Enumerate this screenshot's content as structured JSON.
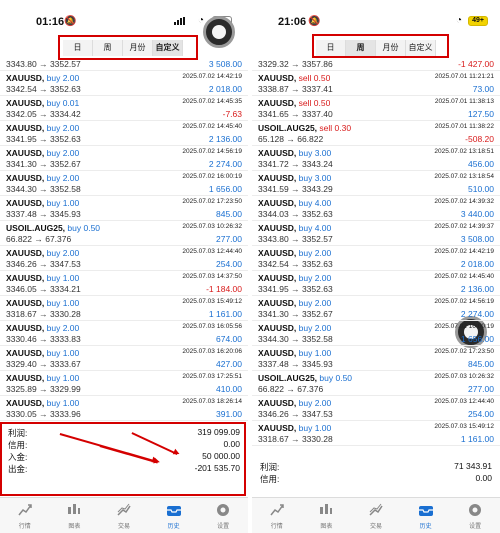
{
  "left": {
    "status": {
      "time": "01:16",
      "battery": ""
    },
    "segments": [
      "日",
      "周",
      "月份",
      "自定义"
    ],
    "active_segment": 3,
    "rows": [
      {
        "symbol": "",
        "dir": "",
        "dirclass": "",
        "datetime": "",
        "prices": "3343.80 → 3352.57",
        "pl": "3 508.00",
        "plclass": "pos",
        "first": true
      },
      {
        "symbol": "XAUUSD,",
        "dir": "buy 2.00",
        "dirclass": "buy",
        "datetime": "2025.07.02 14:42:19",
        "prices": "3342.54 → 3352.63",
        "pl": "2 018.00",
        "plclass": "pos"
      },
      {
        "symbol": "XAUUSD,",
        "dir": "buy 0.01",
        "dirclass": "buy",
        "datetime": "2025.07.02 14:45:35",
        "prices": "3342.05 → 3334.42",
        "pl": "-7.63",
        "plclass": "neg"
      },
      {
        "symbol": "XAUUSD,",
        "dir": "buy 2.00",
        "dirclass": "buy",
        "datetime": "2025.07.02 14:45:40",
        "prices": "3341.95 → 3352.63",
        "pl": "2 136.00",
        "plclass": "pos"
      },
      {
        "symbol": "XAUUSD,",
        "dir": "buy 2.00",
        "dirclass": "buy",
        "datetime": "2025.07.02 14:56:19",
        "prices": "3341.30 → 3352.67",
        "pl": "2 274.00",
        "plclass": "pos"
      },
      {
        "symbol": "XAUUSD,",
        "dir": "buy 2.00",
        "dirclass": "buy",
        "datetime": "2025.07.02 16:00:19",
        "prices": "3344.30 → 3352.58",
        "pl": "1 656.00",
        "plclass": "pos"
      },
      {
        "symbol": "XAUUSD,",
        "dir": "buy 1.00",
        "dirclass": "buy",
        "datetime": "2025.07.02 17:23:50",
        "prices": "3337.48 → 3345.93",
        "pl": "845.00",
        "plclass": "pos"
      },
      {
        "symbol": "USOIL.AUG25,",
        "dir": "buy 0.50",
        "dirclass": "buy",
        "datetime": "2025.07.03 10:26:32",
        "prices": "66.822 → 67.376",
        "pl": "277.00",
        "plclass": "pos"
      },
      {
        "symbol": "XAUUSD,",
        "dir": "buy 2.00",
        "dirclass": "buy",
        "datetime": "2025.07.03 12:44:40",
        "prices": "3346.26 → 3347.53",
        "pl": "254.00",
        "plclass": "pos"
      },
      {
        "symbol": "XAUUSD,",
        "dir": "buy 1.00",
        "dirclass": "buy",
        "datetime": "2025.07.03 14:37:50",
        "prices": "3346.05 → 3334.21",
        "pl": "-1 184.00",
        "plclass": "neg"
      },
      {
        "symbol": "XAUUSD,",
        "dir": "buy 1.00",
        "dirclass": "buy",
        "datetime": "2025.07.03 15:49:12",
        "prices": "3318.67 → 3330.28",
        "pl": "1 161.00",
        "plclass": "pos"
      },
      {
        "symbol": "XAUUSD,",
        "dir": "buy 2.00",
        "dirclass": "buy",
        "datetime": "2025.07.03 16:05:56",
        "prices": "3330.46 → 3333.83",
        "pl": "674.00",
        "plclass": "pos"
      },
      {
        "symbol": "XAUUSD,",
        "dir": "buy 1.00",
        "dirclass": "buy",
        "datetime": "2025.07.03 16:20:06",
        "prices": "3329.40 → 3333.67",
        "pl": "427.00",
        "plclass": "pos"
      },
      {
        "symbol": "XAUUSD,",
        "dir": "buy 1.00",
        "dirclass": "buy",
        "datetime": "2025.07.03 17:25:51",
        "prices": "3325.89 → 3329.99",
        "pl": "410.00",
        "plclass": "pos"
      },
      {
        "symbol": "XAUUSD,",
        "dir": "buy 1.00",
        "dirclass": "buy",
        "datetime": "2025.07.03 18:26:14",
        "prices": "3330.05 → 3333.96",
        "pl": "391.00",
        "plclass": "pos"
      }
    ],
    "summary": [
      {
        "label": "利润:",
        "value": "319 099.09"
      },
      {
        "label": "信用:",
        "value": "0.00"
      },
      {
        "label": "入金:",
        "value": "50 000.00"
      },
      {
        "label": "出金:",
        "value": "-201 535.70"
      }
    ]
  },
  "right": {
    "status": {
      "time": "21:06",
      "battery": "49+"
    },
    "segments": [
      "日",
      "周",
      "月份",
      "自定义"
    ],
    "active_segment": 1,
    "rows": [
      {
        "symbol": "",
        "dir": "",
        "dirclass": "",
        "datetime": "",
        "prices": "3329.32 → 3357.86",
        "pl": "-1 427.00",
        "plclass": "neg",
        "first": true
      },
      {
        "symbol": "XAUUSD,",
        "dir": "sell 0.50",
        "dirclass": "sell",
        "datetime": "2025.07.01 11:21:21",
        "prices": "3338.87 → 3337.41",
        "pl": "73.00",
        "plclass": "pos"
      },
      {
        "symbol": "XAUUSD,",
        "dir": "sell 0.50",
        "dirclass": "sell",
        "datetime": "2025.07.01 11:38:13",
        "prices": "3341.65 → 3337.40",
        "pl": "127.50",
        "plclass": "pos"
      },
      {
        "symbol": "USOIL.AUG25,",
        "dir": "sell 0.30",
        "dirclass": "sell",
        "datetime": "2025.07.01 11:38:22",
        "prices": "65.128 → 66.822",
        "pl": "-508.20",
        "plclass": "neg"
      },
      {
        "symbol": "XAUUSD,",
        "dir": "buy 3.00",
        "dirclass": "buy",
        "datetime": "2025.07.02 13:18:51",
        "prices": "3341.72 → 3343.24",
        "pl": "456.00",
        "plclass": "pos"
      },
      {
        "symbol": "XAUUSD,",
        "dir": "buy 3.00",
        "dirclass": "buy",
        "datetime": "2025.07.02 13:18:54",
        "prices": "3341.59 → 3343.29",
        "pl": "510.00",
        "plclass": "pos"
      },
      {
        "symbol": "XAUUSD,",
        "dir": "buy 4.00",
        "dirclass": "buy",
        "datetime": "2025.07.02 14:39:32",
        "prices": "3344.03 → 3352.63",
        "pl": "3 440.00",
        "plclass": "pos"
      },
      {
        "symbol": "XAUUSD,",
        "dir": "buy 4.00",
        "dirclass": "buy",
        "datetime": "2025.07.02 14:39:37",
        "prices": "3343.80 → 3352.57",
        "pl": "3 508.00",
        "plclass": "pos"
      },
      {
        "symbol": "XAUUSD,",
        "dir": "buy 2.00",
        "dirclass": "buy",
        "datetime": "2025.07.02 14:42:19",
        "prices": "3342.54 → 3352.63",
        "pl": "2 018.00",
        "plclass": "pos"
      },
      {
        "symbol": "XAUUSD,",
        "dir": "buy 2.00",
        "dirclass": "buy",
        "datetime": "2025.07.02 14:45:40",
        "prices": "3341.95 → 3352.63",
        "pl": "2 136.00",
        "plclass": "pos"
      },
      {
        "symbol": "XAUUSD,",
        "dir": "buy 2.00",
        "dirclass": "buy",
        "datetime": "2025.07.02 14:56:19",
        "prices": "3341.30 → 3352.67",
        "pl": "2 274.00",
        "plclass": "pos"
      },
      {
        "symbol": "XAUUSD,",
        "dir": "buy 2.00",
        "dirclass": "buy",
        "datetime": "2025.07.02 16:00:19",
        "prices": "3344.30 → 3352.58",
        "pl": "1 656.00",
        "plclass": "pos"
      },
      {
        "symbol": "XAUUSD,",
        "dir": "buy 1.00",
        "dirclass": "buy",
        "datetime": "2025.07.02 17:23:50",
        "prices": "3337.48 → 3345.93",
        "pl": "845.00",
        "plclass": "pos"
      },
      {
        "symbol": "USOIL.AUG25,",
        "dir": "buy 0.50",
        "dirclass": "buy",
        "datetime": "2025.07.03 10:26:32",
        "prices": "66.822 → 67.376",
        "pl": "277.00",
        "plclass": "pos"
      },
      {
        "symbol": "XAUUSD,",
        "dir": "buy 2.00",
        "dirclass": "buy",
        "datetime": "2025.07.03 12:44:40",
        "prices": "3346.26 → 3347.53",
        "pl": "254.00",
        "plclass": "pos"
      },
      {
        "symbol": "XAUUSD,",
        "dir": "buy 1.00",
        "dirclass": "buy",
        "datetime": "2025.07.03 15:49:12",
        "prices": "3318.67 → 3330.28",
        "pl": "1 161.00",
        "plclass": "pos"
      }
    ],
    "summary": [
      {
        "label": "利润:",
        "value": "71 343.91"
      },
      {
        "label": "信用:",
        "value": "0.00"
      }
    ]
  },
  "tabs": [
    {
      "label": "行情",
      "icon": "quotes-icon"
    },
    {
      "label": "图表",
      "icon": "chart-icon"
    },
    {
      "label": "交易",
      "icon": "trade-icon"
    },
    {
      "label": "历史",
      "icon": "history-icon"
    },
    {
      "label": "设置",
      "icon": "settings-icon"
    }
  ],
  "active_tab": 3,
  "colors": {
    "buy": "#1a6fd1",
    "sell": "#d81b1b",
    "annotation": "#d40000",
    "active_tab": "#1a6fd1"
  }
}
